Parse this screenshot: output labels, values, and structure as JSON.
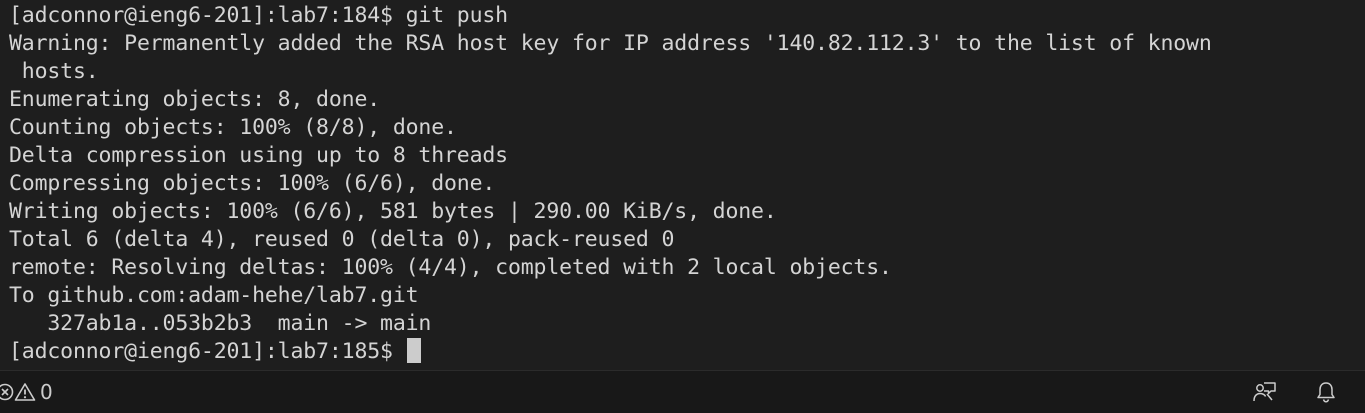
{
  "terminal": {
    "lines": [
      "[adconnor@ieng6-201]:lab7:184$ git push",
      "Warning: Permanently added the RSA host key for IP address '140.82.112.3' to the list of known",
      " hosts.",
      "Enumerating objects: 8, done.",
      "Counting objects: 100% (8/8), done.",
      "Delta compression using up to 8 threads",
      "Compressing objects: 100% (6/6), done.",
      "Writing objects: 100% (6/6), 581 bytes | 290.00 KiB/s, done.",
      "Total 6 (delta 4), reused 0 (delta 0), pack-reused 0",
      "remote: Resolving deltas: 100% (4/4), completed with 2 local objects.",
      "To github.com:adam-hehe/lab7.git",
      "   327ab1a..053b2b3  main -> main"
    ],
    "prompt": "[adconnor@ieng6-201]:lab7:185$ "
  },
  "statusbar": {
    "errors_count": "0",
    "warnings_count": "0",
    "left_icons": [
      "error-icon",
      "warning-icon"
    ],
    "right_icons": [
      "feedback-icon",
      "notifications-bell-icon"
    ]
  }
}
